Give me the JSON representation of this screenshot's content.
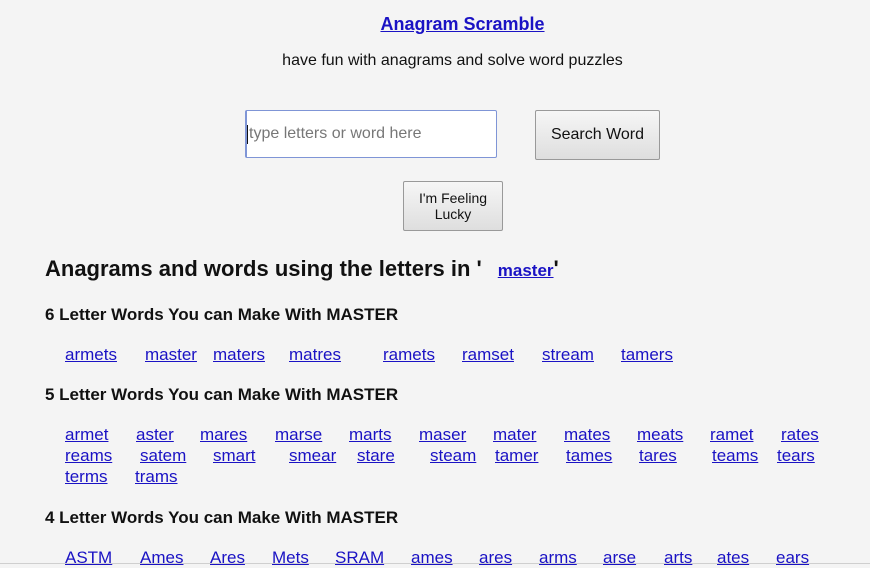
{
  "header": {
    "title": "Anagram Scramble",
    "tagline": "have fun with anagrams and solve word puzzles"
  },
  "search": {
    "value": "",
    "placeholder": "type letters or word here",
    "search_button": "Search Word",
    "lucky_button_line1": "I'm Feeling",
    "lucky_button_line2": "Lucky"
  },
  "results": {
    "heading_prefix": "Anagrams and words using the letters in '",
    "query": "master",
    "heading_suffix": "'",
    "sections": [
      {
        "heading": "6 Letter Words You can Make With MASTER",
        "rows": [
          [
            "armets",
            "master",
            "maters",
            "matres",
            "ramets",
            "ramset",
            "stream",
            "tamers"
          ]
        ]
      },
      {
        "heading": "5 Letter Words You can Make With MASTER",
        "rows": [
          [
            "armet",
            "aster",
            "mares",
            "marse",
            "marts",
            "maser",
            "mater",
            "mates",
            "meats",
            "ramet",
            "rates"
          ],
          [
            "reams",
            "satem",
            "smart",
            "smear",
            "stare",
            "steam",
            "tamer",
            "tames",
            "tares",
            "teams",
            "tears"
          ],
          [
            "terms",
            "trams"
          ]
        ]
      },
      {
        "heading": "4 Letter Words You can Make With MASTER",
        "rows": [
          [
            "ASTM",
            "Ames",
            "Ares",
            "Mets",
            "SRAM",
            "ames",
            "ares",
            "arms",
            "arse",
            "arts",
            "ates",
            "ears"
          ]
        ]
      }
    ]
  }
}
